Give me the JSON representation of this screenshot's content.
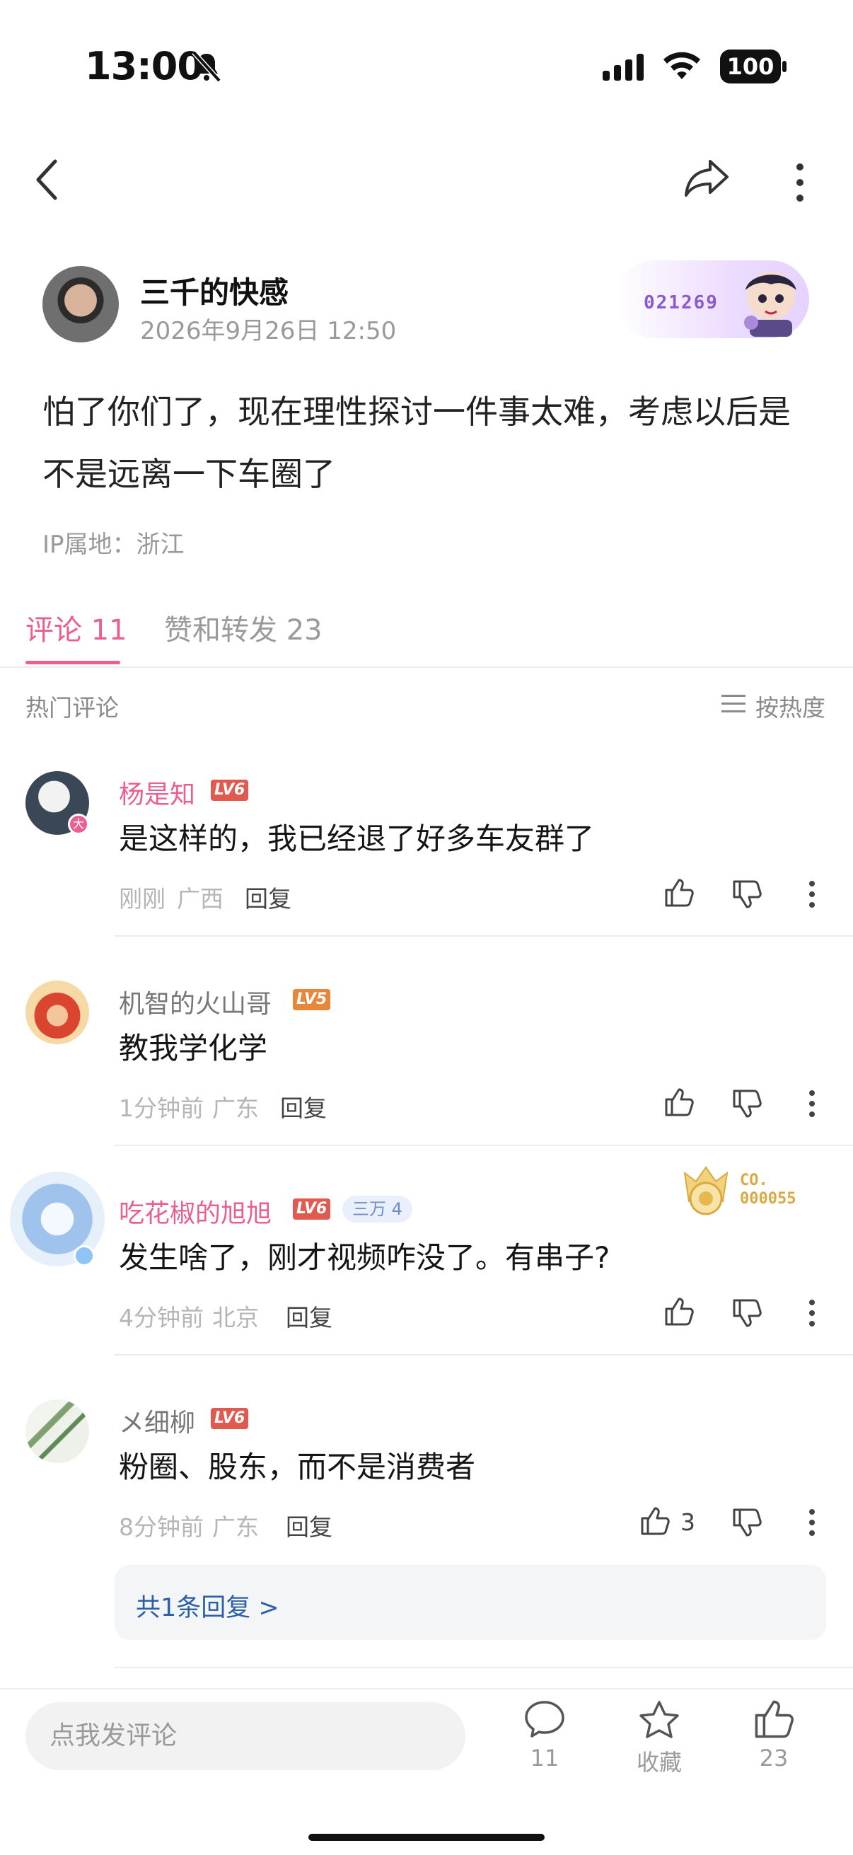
{
  "status_bar": {
    "time": "13:00",
    "battery": "100"
  },
  "post": {
    "author": "三千的快感",
    "date": "2026年9月26日 12:50",
    "badge_number": "021269",
    "text": "怕了你们了，现在理性探讨一件事太难，考虑以后是不是远离一下车圈了",
    "ip": "IP属地：浙江"
  },
  "tabs": [
    {
      "label": "评论 11"
    },
    {
      "label": "赞和转发 23"
    }
  ],
  "section": {
    "hot_label": "热门评论",
    "sort_label": "按热度"
  },
  "comments": [
    {
      "name": "杨是知",
      "level": "LV6",
      "text": "是这样的，我已经退了好多车友群了",
      "time": "刚刚",
      "location": "广西",
      "reply": "回复",
      "likes": ""
    },
    {
      "name": "机智的火山哥",
      "level": "LV5",
      "text": "教我学化学",
      "time": "1分钟前",
      "location": "广东",
      "reply": "回复",
      "likes": ""
    },
    {
      "name": "吃花椒的旭旭",
      "level": "LV6",
      "chip": "三万 4",
      "medal_text": "CO.\n000055",
      "text": "发生啥了，刚才视频咋没了。有串子?",
      "time": "4分钟前",
      "location": "北京",
      "reply": "回复",
      "likes": ""
    },
    {
      "name": "メ细柳",
      "level": "LV6",
      "text": "粉圈、股东，而不是消费者",
      "time": "8分钟前",
      "location": "广东",
      "reply": "回复",
      "likes": "3"
    }
  ],
  "replies_link": "共1条回复 >",
  "bottom_bar": {
    "input_placeholder": "点我发评论",
    "comment_count": "11",
    "favorite_label": "收藏",
    "like_count": "23"
  },
  "colors": {
    "accent": "#ea5f91",
    "link": "#2b5fa6",
    "lv6": "#e05a4f",
    "lv5": "#e8873c"
  }
}
